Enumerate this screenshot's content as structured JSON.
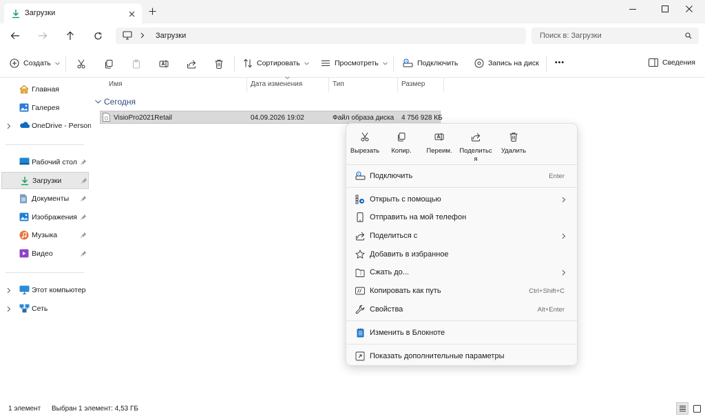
{
  "window": {
    "tab_title": "Загрузки",
    "controls": [
      "minimize-icon",
      "maximize-icon",
      "close-icon"
    ]
  },
  "address": {
    "path": "Загрузки",
    "search_placeholder": "Поиск в: Загрузки"
  },
  "commandbar": {
    "create": "Создать",
    "sort": "Сортировать",
    "view": "Просмотреть",
    "mount": "Подключить",
    "burn": "Запись на диск",
    "more": "•••",
    "details": "Сведения"
  },
  "sidebar": {
    "items": [
      {
        "label": "Главная",
        "icon": "home-icon"
      },
      {
        "label": "Галерея",
        "icon": "gallery-icon"
      },
      {
        "label": "OneDrive - Persona",
        "icon": "onedrive-icon"
      },
      {
        "label": "Рабочий стол",
        "icon": "desktop-icon"
      },
      {
        "label": "Загрузки",
        "icon": "download-icon"
      },
      {
        "label": "Документы",
        "icon": "documents-icon"
      },
      {
        "label": "Изображения",
        "icon": "pictures-icon"
      },
      {
        "label": "Музыка",
        "icon": "music-icon"
      },
      {
        "label": "Видео",
        "icon": "video-icon"
      },
      {
        "label": "Этот компьютер",
        "icon": "this-pc-icon"
      },
      {
        "label": "Сеть",
        "icon": "network-icon"
      }
    ]
  },
  "filelist": {
    "columns": {
      "name": "Имя",
      "date": "Дата изменения",
      "type": "Тип",
      "size": "Размер"
    },
    "group": "Сегодня",
    "rows": [
      {
        "name": "VisioPro2021Retail",
        "date": "04.09.2026 19:02",
        "type": "Файл образа диска",
        "size": "4 756 928 КБ"
      }
    ]
  },
  "status": {
    "count": "1 элемент",
    "selection": "Выбран 1 элемент: 4,53 ГБ"
  },
  "context_menu": {
    "quick_actions": [
      {
        "label": "Вырезать",
        "icon": "cut-icon"
      },
      {
        "label": "Копир.",
        "icon": "copy-icon"
      },
      {
        "label": "Переим.",
        "icon": "rename-icon"
      },
      {
        "label": "Поделитьс я",
        "icon": "share-icon"
      },
      {
        "label": "Удалить",
        "icon": "delete-icon"
      }
    ],
    "items": [
      {
        "label": "Подключить",
        "shortcut": "Enter"
      },
      {
        "label": "Открыть с помощью"
      },
      {
        "label": "Отправить на мой телефон"
      },
      {
        "label": "Поделиться с"
      },
      {
        "label": "Добавить в избранное"
      },
      {
        "label": "Сжать до..."
      },
      {
        "label": "Копировать как путь",
        "shortcut": "Ctrl+Shift+C"
      },
      {
        "label": "Свойства",
        "shortcut": "Alt+Enter"
      },
      {
        "label": "Изменить в Блокноте"
      },
      {
        "label": "Показать дополнительные параметры"
      }
    ]
  },
  "colors": {
    "accent": "#0067c0",
    "selection_bg": "#d9d9d9",
    "chrome_bg": "#f3f3f3",
    "group_header": "#2e4b7c"
  }
}
